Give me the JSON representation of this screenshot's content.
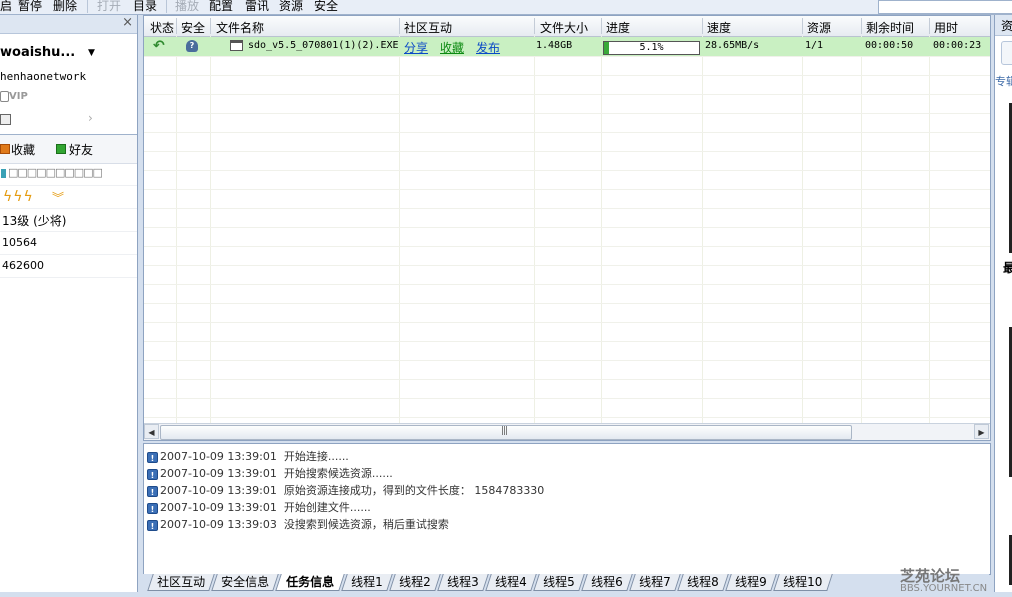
{
  "toolbar": {
    "items": [
      {
        "label": "暂停",
        "enabled": true
      },
      {
        "label": "删除",
        "enabled": true
      },
      {
        "label": "打开",
        "enabled": false
      },
      {
        "label": "目录",
        "enabled": true
      },
      {
        "label": "播放",
        "enabled": false
      },
      {
        "label": "配置",
        "enabled": true
      },
      {
        "label": "雷讯",
        "enabled": true
      },
      {
        "label": "资源",
        "enabled": true
      },
      {
        "label": "安全",
        "enabled": true
      }
    ],
    "partial_left": "启"
  },
  "left_panel": {
    "close_icon": "×",
    "username": "woaishu...",
    "account": "henhaonetwork",
    "vip_label": "VIP",
    "tabs": {
      "favorites": "收藏",
      "friends": "好友"
    },
    "status_boxes": "□□□□□□□□□□",
    "level": "13级 (少将)",
    "stat1": "10564",
    "stat2": "462600"
  },
  "task_table": {
    "headers": [
      "状态",
      "安全",
      "文件名称",
      "社区互动",
      "文件大小",
      "进度",
      "速度",
      "资源",
      "剩余时间",
      "用时"
    ],
    "rows": [
      {
        "file_name": "sdo_v5.5_070801(1)(2).EXE",
        "share": "分享",
        "favorite": "收藏",
        "publish": "发布",
        "size": "1.48GB",
        "progress_text": "5.1%",
        "progress": 0.051,
        "speed": "28.65MB/s",
        "sources": "1/1",
        "remaining": "00:00:50",
        "elapsed": "00:00:23"
      }
    ]
  },
  "log": [
    {
      "time": "2007-10-09 13:39:01",
      "msg": "开始连接......"
    },
    {
      "time": "2007-10-09 13:39:01",
      "msg": "开始搜索候选资源......"
    },
    {
      "time": "2007-10-09 13:39:01",
      "msg": "原始资源连接成功，得到的文件长度： 1584783330"
    },
    {
      "time": "2007-10-09 13:39:01",
      "msg": "开始创建文件......"
    },
    {
      "time": "2007-10-09 13:39:03",
      "msg": "没搜索到候选资源，稍后重试搜索"
    }
  ],
  "bottom_tabs": [
    "社区互动",
    "安全信息",
    "任务信息",
    "线程1",
    "线程2",
    "线程3",
    "线程4",
    "线程5",
    "线程6",
    "线程7",
    "线程8",
    "线程9",
    "线程10"
  ],
  "active_tab_index": 2,
  "right_panel": {
    "t1": "资",
    "t2": "专辑",
    "t3": "最"
  },
  "watermark": {
    "line1": "芝苑论坛",
    "line2": "BBS.YOURNET.CN"
  },
  "colors": {
    "row_selected": "#c9f0c2",
    "link": "#0a49c7",
    "link_green": "#0d8a12",
    "progress_fill": "#3aa83a"
  }
}
